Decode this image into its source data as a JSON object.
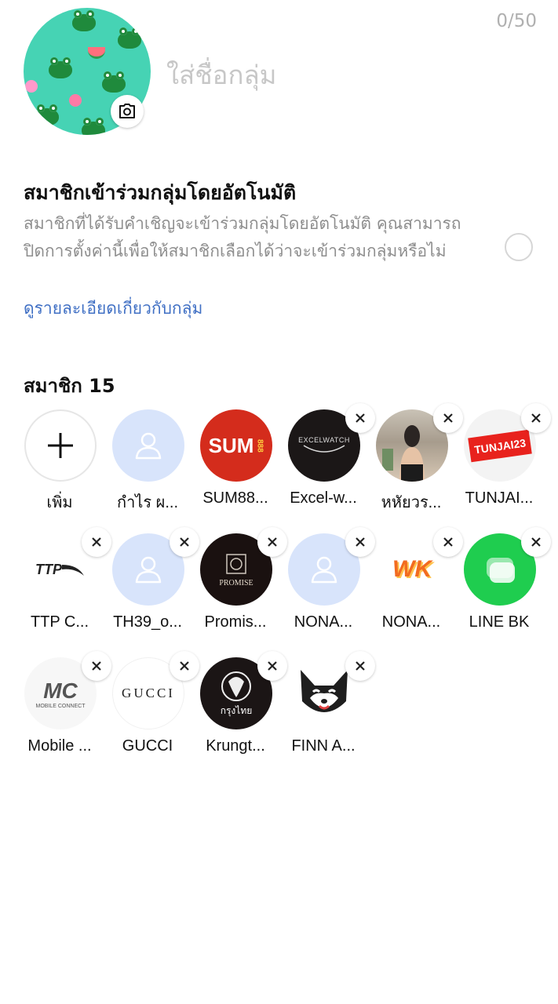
{
  "header": {
    "name_placeholder": "ใส่ชื่อกลุ่ม",
    "char_count": "0/50"
  },
  "auto_join": {
    "title": "สมาชิกเข้าร่วมกลุ่มโดยอัตโนมัติ",
    "description": "สมาชิกที่ได้รับคำเชิญจะเข้าร่วมกลุ่มโดยอัตโนมัติ คุณสามารถปิดการตั้งค่านี้เพื่อให้สมาชิกเลือกได้ว่าจะเข้าร่วมกลุ่มหรือไม่",
    "link": "ดูรายละเอียดเกี่ยวกับกลุ่ม",
    "enabled": false
  },
  "members": {
    "header": "สมาชิก 15",
    "add_label": "เพิ่ม",
    "items": [
      {
        "name": "กำไร ผ...",
        "avatar": "person-placeholder-icon",
        "removable": false
      },
      {
        "name": "SUM88...",
        "avatar": "sum888-logo",
        "logo_text": "SUM",
        "removable": false
      },
      {
        "name": "Excel-w...",
        "avatar": "excelwatch-logo",
        "logo_text": "EXCELWATCH",
        "removable": true
      },
      {
        "name": "หหัยวร...",
        "avatar": "profile-photo",
        "removable": true
      },
      {
        "name": "TUNJAI...",
        "avatar": "tunjai23-logo",
        "logo_text": "TUNJAI23",
        "removable": true
      },
      {
        "name": "TTP C...",
        "avatar": "ttp-logo",
        "logo_text": "TTP",
        "removable": true
      },
      {
        "name": "TH39_o...",
        "avatar": "person-placeholder-icon",
        "removable": true
      },
      {
        "name": "Promis...",
        "avatar": "promise-logo",
        "logo_text": "PROMISE",
        "removable": true
      },
      {
        "name": "NONA...",
        "avatar": "person-placeholder-icon",
        "removable": true
      },
      {
        "name": "NONA...",
        "avatar": "wk-logo",
        "logo_text": "WK",
        "removable": true
      },
      {
        "name": "LINE BK",
        "avatar": "line-bk-logo",
        "removable": true
      },
      {
        "name": "Mobile ...",
        "avatar": "mobile-connect-logo",
        "logo_text": "MC",
        "removable": true
      },
      {
        "name": "GUCCI",
        "avatar": "gucci-logo",
        "logo_text": "GUCCI",
        "removable": true
      },
      {
        "name": "Krungt...",
        "avatar": "krungthai-logo",
        "logo_text": "กรุงไทย",
        "removable": true
      },
      {
        "name": "FINN A...",
        "avatar": "fox-logo",
        "removable": true
      }
    ]
  },
  "colors": {
    "link": "#3f6fc4",
    "placeholder_avatar": "#d8e4fb",
    "group_photo_bg": "#46d3b4"
  }
}
